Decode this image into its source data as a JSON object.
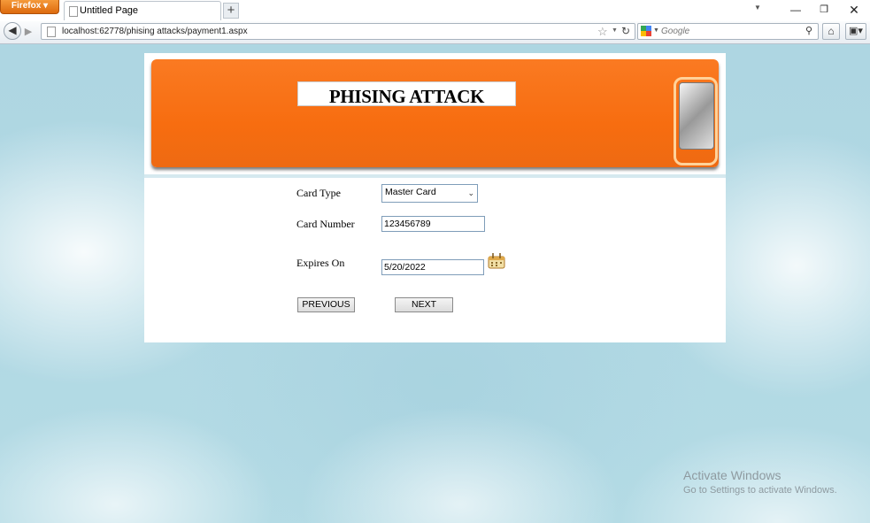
{
  "browser": {
    "menu_button": "Firefox",
    "tab_title": "Untitled Page",
    "new_tab_symbol": "+",
    "url": "localhost:62778/phising attacks/payment1.aspx",
    "search_placeholder": "Google"
  },
  "page": {
    "banner_title": "PHISING ATTACK",
    "form": {
      "card_type_label": "Card Type",
      "card_type_value": "Master Card",
      "card_number_label": "Card Number",
      "card_number_value": "123456789",
      "expires_label": "Expires On",
      "expires_value": "5/20/2022",
      "previous_label": "PREVIOUS",
      "next_label": "NEXT"
    }
  },
  "watermark": {
    "line1": "Activate Windows",
    "line2": "Go to Settings to activate Windows."
  },
  "colors": {
    "banner": "#f76d10",
    "firefox_button": "#e8781a",
    "background": "#b7dde6"
  }
}
